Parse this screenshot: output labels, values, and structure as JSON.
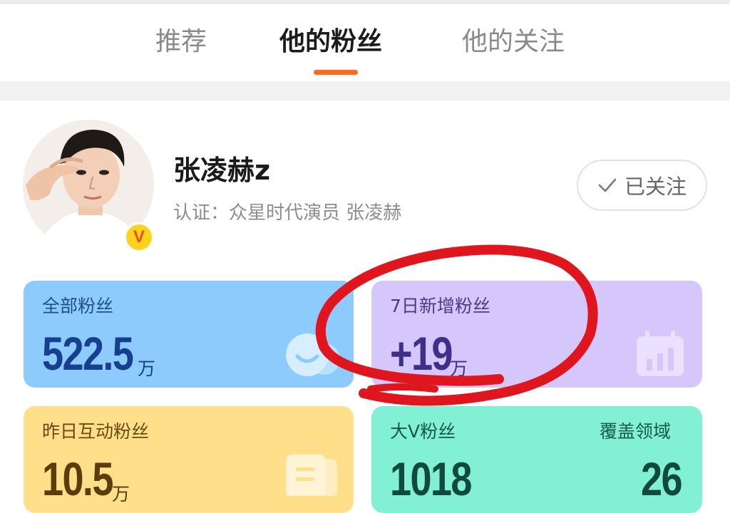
{
  "tabs": [
    {
      "label": "推荐"
    },
    {
      "label": "他的粉丝"
    },
    {
      "label": "他的关注"
    }
  ],
  "active_tab": "他的粉丝",
  "profile": {
    "name": "张凌赫z",
    "certification": "认证：众星时代演员 张凌赫",
    "badge": "V",
    "follow_button": "已关注"
  },
  "stats": {
    "all_fans": {
      "label": "全部粉丝",
      "value": "522.5",
      "unit": "万"
    },
    "new_fans_7d": {
      "label": "7日新增粉丝",
      "value": "+19",
      "unit": "万"
    },
    "interactive_yesterday": {
      "label": "昨日互动粉丝",
      "value": "10.5",
      "unit": "万"
    },
    "big_v": {
      "label": "大V粉丝",
      "value": "1018",
      "coverage_label": "覆盖领域",
      "coverage_value": "26"
    }
  },
  "colors": {
    "accent": "#ff6b1a",
    "card_blue": "#8ccbfc",
    "card_purple": "#d5c6fb",
    "card_yellow": "#ffdf8a",
    "card_green": "#82f0d4",
    "annotation_red": "#e0161f"
  }
}
